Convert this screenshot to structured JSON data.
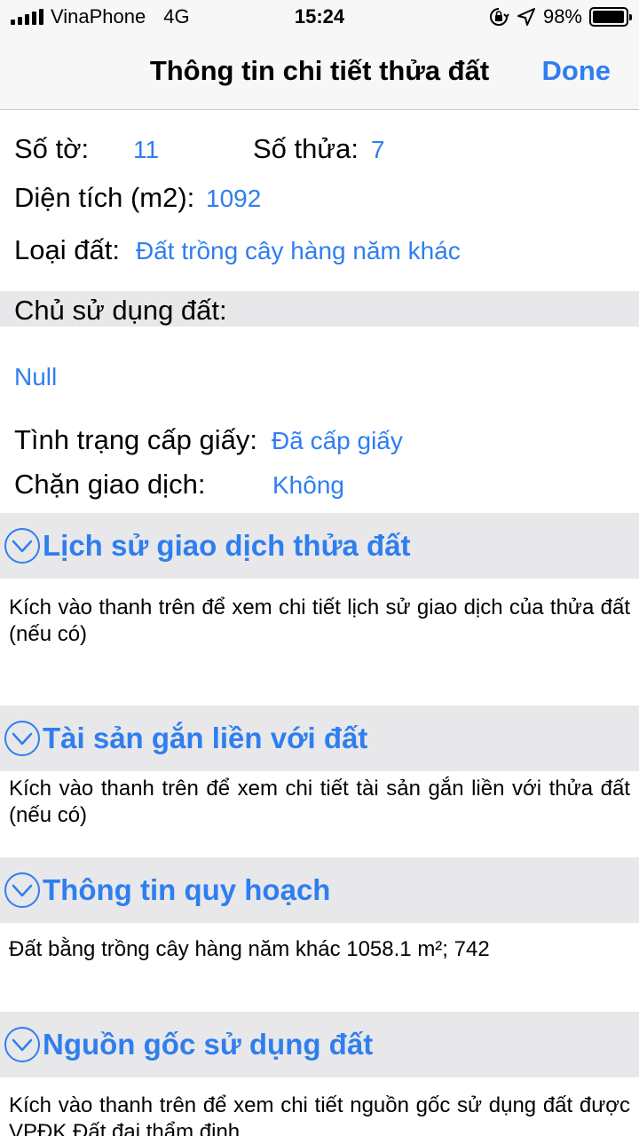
{
  "status": {
    "carrier": "VinaPhone",
    "network": "4G",
    "time": "15:24",
    "battery_text": "98%",
    "battery_level": 0.98,
    "icons": [
      "signal-icon",
      "orientation-lock-icon",
      "location-arrow-icon",
      "battery-icon"
    ]
  },
  "nav": {
    "title": "Thông tin chi tiết thửa đất",
    "done": "Done"
  },
  "parcel": {
    "so_to_label": "Số tờ:",
    "so_to_value": "11",
    "so_thua_label": "Số thửa:",
    "so_thua_value": "7",
    "dien_tich_label": "Diện tích (m2):",
    "dien_tich_value": "1092",
    "loai_dat_label": "Loại đất:",
    "loai_dat_value": "Đất trồng cây hàng năm khác"
  },
  "owner": {
    "heading": "Chủ sử dụng đất:",
    "value": "Null"
  },
  "status_info": {
    "cap_giay_label": "Tình trạng cấp giấy:",
    "cap_giay_value": "Đã cấp giấy",
    "chan_gd_label": "Chặn giao dịch:",
    "chan_gd_value": "Không"
  },
  "sections": [
    {
      "title": "Lịch sử giao dịch thửa đất",
      "desc": "Kích vào thanh trên để xem chi tiết lịch sử giao dịch của thửa đất (nếu có)"
    },
    {
      "title": "Tài sản gắn liền với đất",
      "desc": "Kích vào thanh trên để xem chi tiết tài sản gắn liền với thửa đất (nếu có)"
    },
    {
      "title": "Thông tin quy hoạch",
      "desc": "Đất bằng trồng cây hàng năm khác 1058.1 m²; 742"
    },
    {
      "title": "Nguồn gốc sử dụng đất",
      "desc": "Kích vào thanh trên để xem chi tiết nguồn gốc sử dụng đất được VPĐK Đất đai thẩm định"
    }
  ],
  "colors": {
    "accent": "#2f7ef0",
    "band": "#e8e8ea"
  }
}
